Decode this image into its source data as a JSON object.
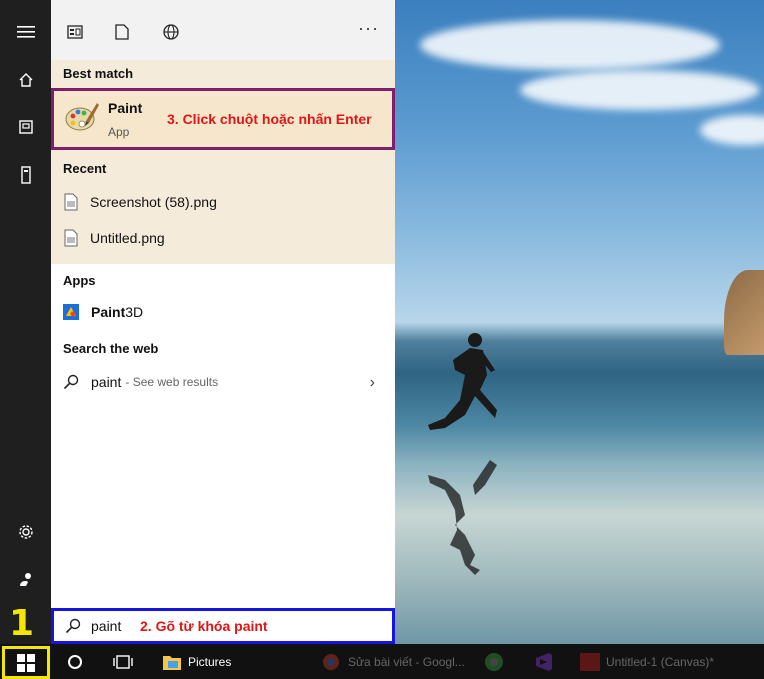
{
  "toolbar": {
    "more_label": "···"
  },
  "results": {
    "best_match_title": "Best match",
    "best": {
      "name": "Paint",
      "type": "App"
    },
    "annotation_3": "3. Click chuột hoặc nhấn Enter",
    "recent_title": "Recent",
    "recent": [
      "Screenshot (58).png",
      "Untitled.png"
    ]
  },
  "apps": {
    "title": "Apps",
    "item_bold": "Paint",
    "item_rest": " 3D"
  },
  "web": {
    "title": "Search the web",
    "query": "paint",
    "hint": "- See web results"
  },
  "search": {
    "value": "paint",
    "annotation_2": "2. Gõ từ khóa paint"
  },
  "annotation_1": "1",
  "taskbar": {
    "pictures": "Pictures",
    "chrome_task": "Sửa bài viết - Googl...",
    "canvas_task": "Untitled-1 (Canvas)*"
  },
  "icons": {
    "rail": [
      "hamburger-icon",
      "home-icon",
      "documents-icon",
      "tower-icon",
      "settings-icon",
      "user-icon"
    ],
    "toolbar": [
      "apps-view-icon",
      "document-icon",
      "globe-icon"
    ]
  },
  "colors": {
    "best_border": "#7d1f6b",
    "search_border": "#1414e6",
    "start_border": "#f3e600",
    "annotation_red": "#e01515"
  }
}
